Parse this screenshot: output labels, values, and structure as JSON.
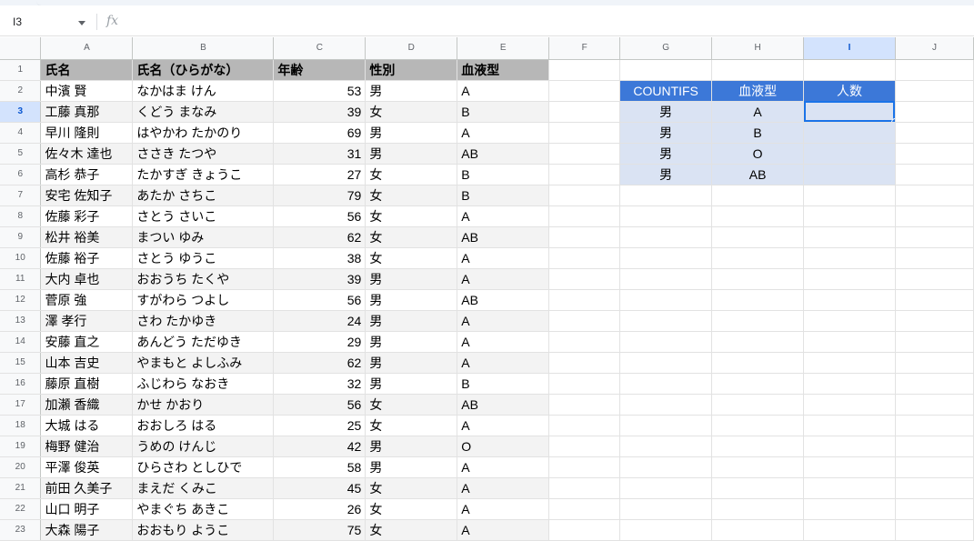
{
  "formula_bar": {
    "name_box": "I3",
    "fx_label": "fx"
  },
  "columns": [
    "A",
    "B",
    "C",
    "D",
    "E",
    "F",
    "G",
    "H",
    "I",
    "J"
  ],
  "selected_column": "I",
  "selected_row": 3,
  "header_row": {
    "a": "氏名",
    "b": "氏名（ひらがな）",
    "c": "年齢",
    "d": "性別",
    "e": "血液型"
  },
  "rows": [
    {
      "a": "中濱 賢",
      "b": "なかはま けん",
      "c": "53",
      "d": "男",
      "e": "A"
    },
    {
      "a": "工藤 真那",
      "b": "くどう まなみ",
      "c": "39",
      "d": "女",
      "e": "B"
    },
    {
      "a": "早川 隆則",
      "b": "はやかわ たかのり",
      "c": "69",
      "d": "男",
      "e": "A"
    },
    {
      "a": "佐々木 達也",
      "b": "ささき たつや",
      "c": "31",
      "d": "男",
      "e": "AB"
    },
    {
      "a": "高杉 恭子",
      "b": "たかすぎ きょうこ",
      "c": "27",
      "d": "女",
      "e": "B"
    },
    {
      "a": "安宅 佐知子",
      "b": "あたか さちこ",
      "c": "79",
      "d": "女",
      "e": "B"
    },
    {
      "a": "佐藤 彩子",
      "b": "さとう さいこ",
      "c": "56",
      "d": "女",
      "e": "A"
    },
    {
      "a": "松井 裕美",
      "b": "まつい ゆみ",
      "c": "62",
      "d": "女",
      "e": "AB"
    },
    {
      "a": "佐藤 裕子",
      "b": "さとう ゆうこ",
      "c": "38",
      "d": "女",
      "e": "A"
    },
    {
      "a": "大内 卓也",
      "b": "おおうち たくや",
      "c": "39",
      "d": "男",
      "e": "A"
    },
    {
      "a": "菅原 強",
      "b": "すがわら つよし",
      "c": "56",
      "d": "男",
      "e": "AB"
    },
    {
      "a": "澤 孝行",
      "b": "さわ たかゆき",
      "c": "24",
      "d": "男",
      "e": "A"
    },
    {
      "a": "安藤 直之",
      "b": "あんどう ただゆき",
      "c": "29",
      "d": "男",
      "e": "A"
    },
    {
      "a": "山本 吉史",
      "b": "やまもと よしふみ",
      "c": "62",
      "d": "男",
      "e": "A"
    },
    {
      "a": "藤原 直樹",
      "b": "ふじわら なおき",
      "c": "32",
      "d": "男",
      "e": "B"
    },
    {
      "a": "加瀬 香織",
      "b": "かせ かおり",
      "c": "56",
      "d": "女",
      "e": "AB"
    },
    {
      "a": "大城 はる",
      "b": "おおしろ はる",
      "c": "25",
      "d": "女",
      "e": "A"
    },
    {
      "a": "梅野 健治",
      "b": "うめの けんじ",
      "c": "42",
      "d": "男",
      "e": "O"
    },
    {
      "a": "平澤 俊英",
      "b": "ひらさわ としひで",
      "c": "58",
      "d": "男",
      "e": "A"
    },
    {
      "a": "前田 久美子",
      "b": "まえだ くみこ",
      "c": "45",
      "d": "女",
      "e": "A"
    },
    {
      "a": "山口 明子",
      "b": "やまぐち あきこ",
      "c": "26",
      "d": "女",
      "e": "A"
    },
    {
      "a": "大森 陽子",
      "b": "おおもり ようこ",
      "c": "75",
      "d": "女",
      "e": "A"
    }
  ],
  "countifs_table": {
    "headers": [
      "COUNTIFS",
      "血液型",
      "人数"
    ],
    "rows": [
      {
        "gender": "男",
        "blood": "A",
        "count": ""
      },
      {
        "gender": "男",
        "blood": "B",
        "count": ""
      },
      {
        "gender": "男",
        "blood": "O",
        "count": ""
      },
      {
        "gender": "男",
        "blood": "AB",
        "count": ""
      }
    ]
  },
  "colors": {
    "header_fill": "#b7b7b7",
    "band_fill": "#f3f3f3",
    "countifs_header": "#3c78d8",
    "countifs_body": "#dae3f3",
    "selection": "#1a73e8"
  }
}
